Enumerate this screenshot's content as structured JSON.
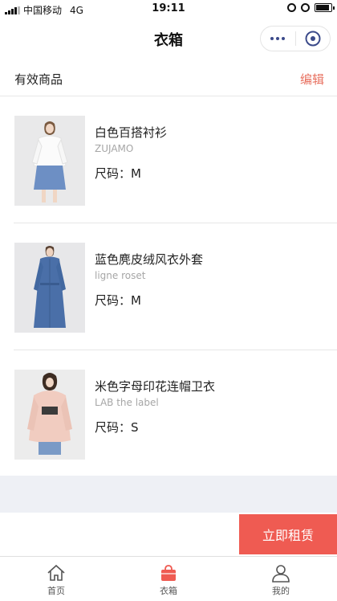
{
  "status_bar": {
    "carrier": "中国移动",
    "network": "4G",
    "time": "19:11"
  },
  "nav": {
    "title": "衣箱"
  },
  "section": {
    "title": "有效商品",
    "edit_label": "编辑"
  },
  "size_prefix": "尺码：",
  "products": [
    {
      "name": "白色百搭衬衫",
      "brand": "ZUJAMO",
      "size": "M",
      "image_icon": "white-shirt-photo"
    },
    {
      "name": "蓝色麂皮绒风衣外套",
      "brand": "ligne roset",
      "size": "M",
      "image_icon": "blue-trench-coat-photo"
    },
    {
      "name": "米色字母印花连帽卫衣",
      "brand": "LAB the label",
      "size": "S",
      "image_icon": "beige-hoodie-photo"
    }
  ],
  "cta": {
    "rent_label": "立即租赁"
  },
  "tabs": [
    {
      "label": "首页",
      "icon": "home-icon",
      "active": false
    },
    {
      "label": "衣箱",
      "icon": "bag-icon",
      "active": true
    },
    {
      "label": "我的",
      "icon": "user-icon",
      "active": false
    }
  ],
  "colors": {
    "accent": "#ef5b52",
    "edit_text": "#e8705f",
    "brand_text": "#a6a6a6"
  }
}
